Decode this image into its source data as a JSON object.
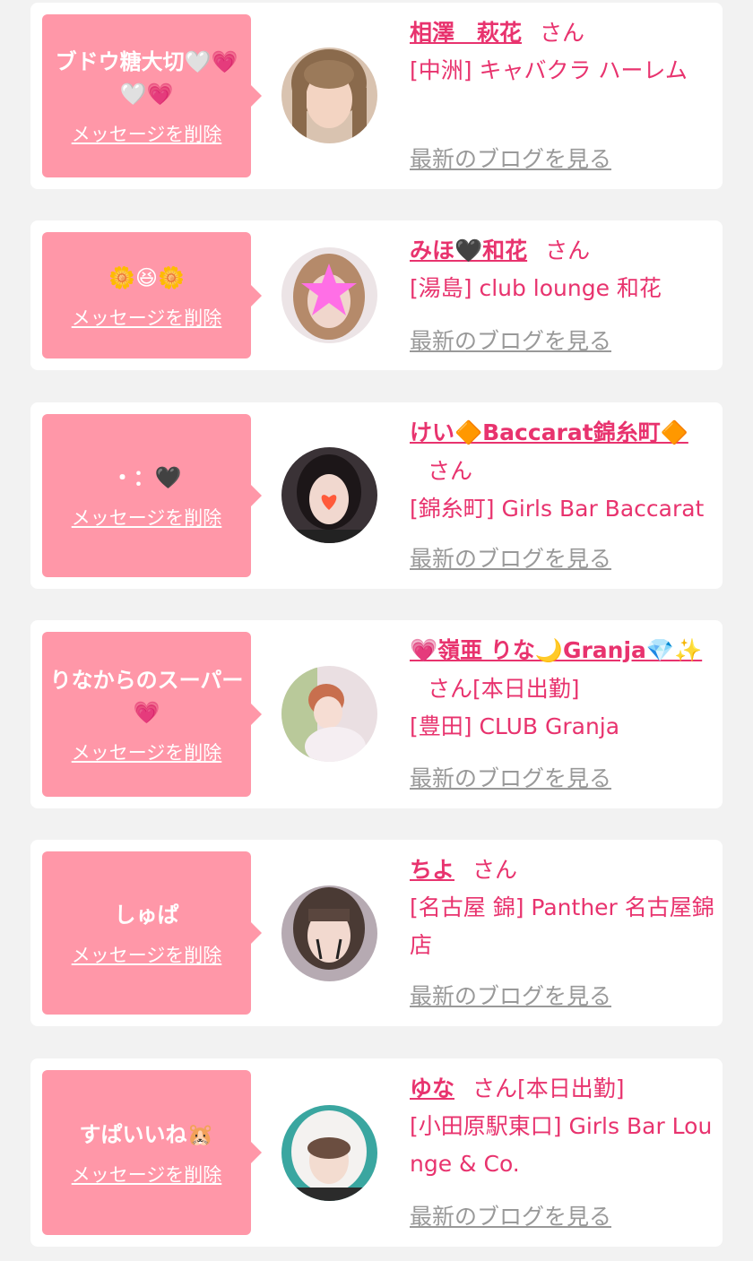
{
  "cards": [
    {
      "message": "ブドウ糖大切🤍💗🤍💗",
      "delete_label": "メッセージを削除",
      "name": "相澤　萩花",
      "san": "さん",
      "status": "",
      "shop": "[中洲] キャバクラ ハーレム",
      "blog_label": "最新のブログを見る"
    },
    {
      "message": "🌼😆🌼",
      "delete_label": "メッセージを削除",
      "name": "みほ🖤和花",
      "san": "さん",
      "status": "",
      "shop": "[湯島] club lounge 和花",
      "blog_label": "最新のブログを見る"
    },
    {
      "message": "・：🖤",
      "delete_label": "メッセージを削除",
      "name": "けい🔶Baccarat錦糸町🔶",
      "san": "さん",
      "status": "",
      "shop": "[錦糸町] Girls Bar Baccarat",
      "blog_label": "最新のブログを見る"
    },
    {
      "message": "りなからのスーパー💗",
      "delete_label": "メッセージを削除",
      "name": "💗嶺亜 りな🌙Granja💎✨",
      "san": "さん",
      "status": "[本日出勤]",
      "shop": "[豊田] CLUB Granja",
      "blog_label": "最新のブログを見る"
    },
    {
      "message": "しゅぱ",
      "delete_label": "メッセージを削除",
      "name": "ちよ",
      "san": "さん",
      "status": "",
      "shop": "[名古屋 錦] Panther 名古屋錦店",
      "blog_label": "最新のブログを見る"
    },
    {
      "message": "すぱいいね🐹",
      "delete_label": "メッセージを削除",
      "name": "ゆな",
      "san": "さん",
      "status": "[本日出勤]",
      "shop": "[小田原駅東口] Girls Bar Lounge & Co.",
      "blog_label": "最新のブログを見る"
    }
  ],
  "colors": {
    "background": "#f2f2f2",
    "card": "#ffffff",
    "bubble": "#ff97a8",
    "accent": "#e8336e",
    "link_gray": "#999999"
  }
}
